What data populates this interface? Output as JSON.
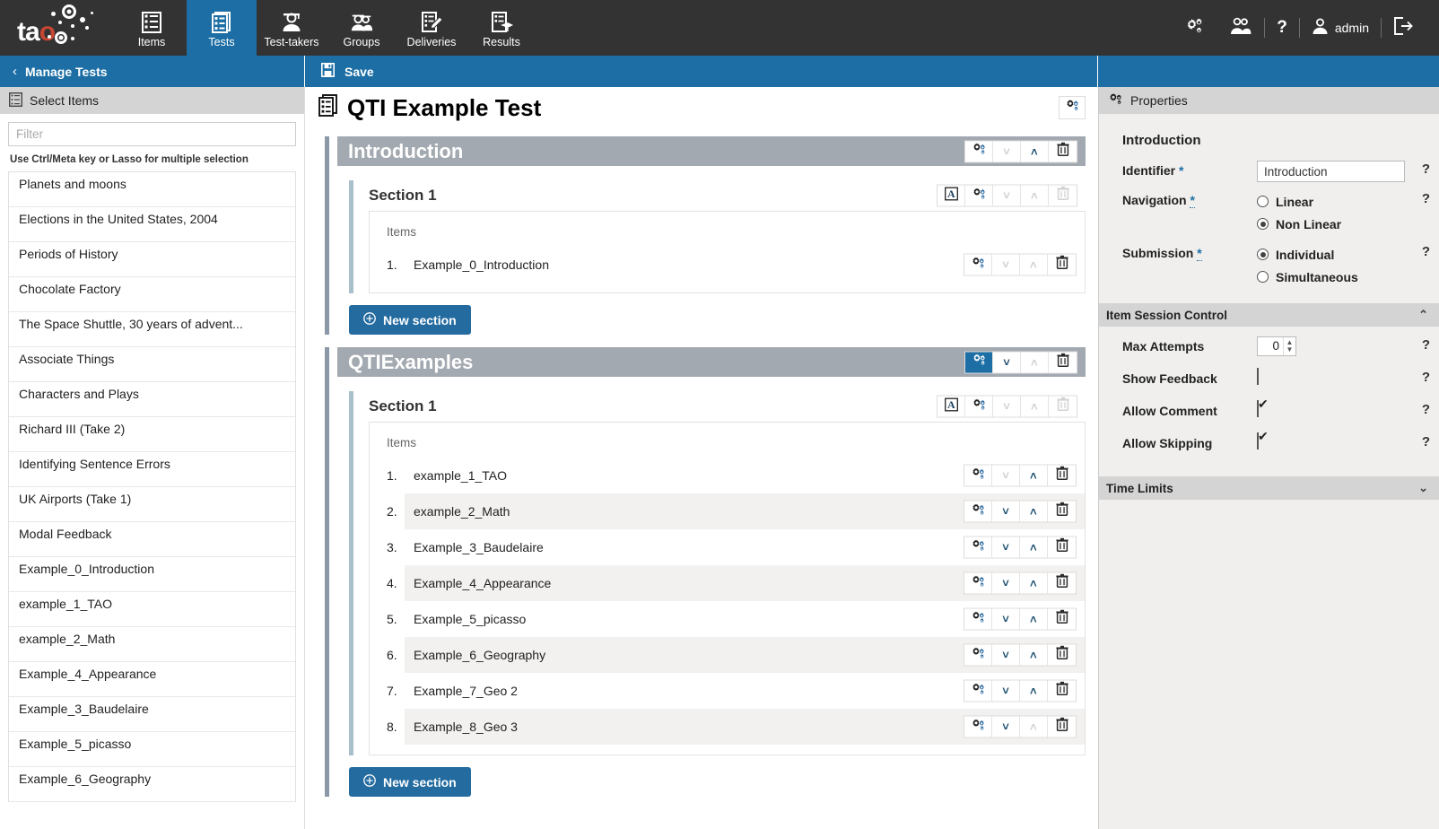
{
  "topnav": {
    "logo_alt": "tao",
    "items": [
      {
        "label": "Items",
        "icon": "items-icon",
        "active": false
      },
      {
        "label": "Tests",
        "icon": "tests-icon",
        "active": true
      },
      {
        "label": "Test-takers",
        "icon": "test-takers-icon",
        "active": false
      },
      {
        "label": "Groups",
        "icon": "groups-icon",
        "active": false
      },
      {
        "label": "Deliveries",
        "icon": "deliveries-icon",
        "active": false
      },
      {
        "label": "Results",
        "icon": "results-icon",
        "active": false
      }
    ],
    "settings_icon": "gear-settings-icon",
    "users_icon": "users-icon",
    "help_icon": "help-question-icon",
    "user_icon": "user-avatar-icon",
    "username": "admin",
    "logout_icon": "logout-icon"
  },
  "bar2": {
    "back_label": "Manage Tests",
    "back_chevron": "‹",
    "save_label": "Save",
    "save_icon": "save-disk-icon"
  },
  "left_panel": {
    "header": "Select Items",
    "header_icon": "list-items-icon",
    "filter_placeholder": "Filter",
    "filter_value": "",
    "hint": "Use Ctrl/Meta key or Lasso for multiple selection",
    "items": [
      "Planets and moons",
      "Elections in the United States, 2004",
      "Periods of History",
      "Chocolate Factory",
      "The Space Shuttle, 30 years of advent...",
      "Associate Things",
      "Characters and Plays",
      "Richard III (Take 2)",
      "Identifying Sentence Errors",
      "UK Airports (Take 1)",
      "Modal Feedback",
      "Example_0_Introduction",
      "example_1_TAO",
      "example_2_Math",
      "Example_4_Appearance",
      "Example_3_Baudelaire",
      "Example_5_picasso",
      "Example_6_Geography"
    ]
  },
  "center": {
    "test_title": "QTI Example Test",
    "test_title_icon": "test-document-icon",
    "title_gear_icon": "gear-settings-icon",
    "items_header": "Items",
    "new_section_label": "New section",
    "new_section_icon": "plus-circle-icon",
    "test_parts": [
      {
        "title": "Introduction",
        "gear_active": false,
        "up_enabled": false,
        "down_enabled": true,
        "sections": [
          {
            "title": "Section 1",
            "has_rubric_button": true,
            "rubric_icon": "rubric-A-icon",
            "up_enabled": false,
            "down_enabled": false,
            "items": [
              {
                "num": "1.",
                "name": "Example_0_Introduction",
                "up_enabled": false,
                "down_enabled": false
              }
            ]
          }
        ]
      },
      {
        "title": "QTIExamples",
        "gear_active": true,
        "up_enabled": true,
        "down_enabled": false,
        "sections": [
          {
            "title": "Section 1",
            "has_rubric_button": true,
            "rubric_icon": "rubric-A-icon",
            "up_enabled": false,
            "down_enabled": false,
            "items": [
              {
                "num": "1.",
                "name": "example_1_TAO",
                "up_enabled": false,
                "down_enabled": true
              },
              {
                "num": "2.",
                "name": "example_2_Math",
                "up_enabled": true,
                "down_enabled": true
              },
              {
                "num": "3.",
                "name": "Example_3_Baudelaire",
                "up_enabled": true,
                "down_enabled": true
              },
              {
                "num": "4.",
                "name": "Example_4_Appearance",
                "up_enabled": true,
                "down_enabled": true
              },
              {
                "num": "5.",
                "name": "Example_5_picasso",
                "up_enabled": true,
                "down_enabled": true
              },
              {
                "num": "6.",
                "name": "Example_6_Geography",
                "up_enabled": true,
                "down_enabled": true
              },
              {
                "num": "7.",
                "name": "Example_7_Geo 2",
                "up_enabled": true,
                "down_enabled": true
              },
              {
                "num": "8.",
                "name": "Example_8_Geo 3",
                "up_enabled": true,
                "down_enabled": false
              }
            ]
          }
        ]
      }
    ]
  },
  "right_panel": {
    "header": "Properties",
    "header_icon": "gear-settings-icon",
    "subject": "Introduction",
    "fields": [
      {
        "label": "Identifier",
        "required": true,
        "dotted": false,
        "type": "text",
        "value": "Introduction",
        "help": "?"
      },
      {
        "label": "Navigation",
        "required": true,
        "dotted": true,
        "type": "radio",
        "help": "?",
        "options": [
          {
            "label": "Linear",
            "selected": false
          },
          {
            "label": "Non Linear",
            "selected": true
          }
        ]
      },
      {
        "label": "Submission",
        "required": true,
        "dotted": true,
        "type": "radio",
        "help": "?",
        "options": [
          {
            "label": "Individual",
            "selected": true
          },
          {
            "label": "Simultaneous",
            "selected": false
          }
        ]
      }
    ],
    "item_session_control": {
      "title": "Item Session Control",
      "expanded": true,
      "chevron": "⌃",
      "fields": [
        {
          "label": "Max Attempts",
          "type": "spinner",
          "value": "0",
          "help": "?"
        },
        {
          "label": "Show Feedback",
          "type": "checkbox",
          "checked": false,
          "help": "?"
        },
        {
          "label": "Allow Comment",
          "type": "checkbox",
          "checked": true,
          "help": "?"
        },
        {
          "label": "Allow Skipping",
          "type": "checkbox",
          "checked": true,
          "help": "?"
        }
      ]
    },
    "time_limits": {
      "title": "Time Limits",
      "expanded": false,
      "chevron": "⌄"
    }
  },
  "colors": {
    "accent_blue": "#1c6ea4",
    "nav_dark": "#333333",
    "testpart_header": "#a3a9b0",
    "panel_bg": "#f0efed",
    "logo_red": "#c74634"
  }
}
